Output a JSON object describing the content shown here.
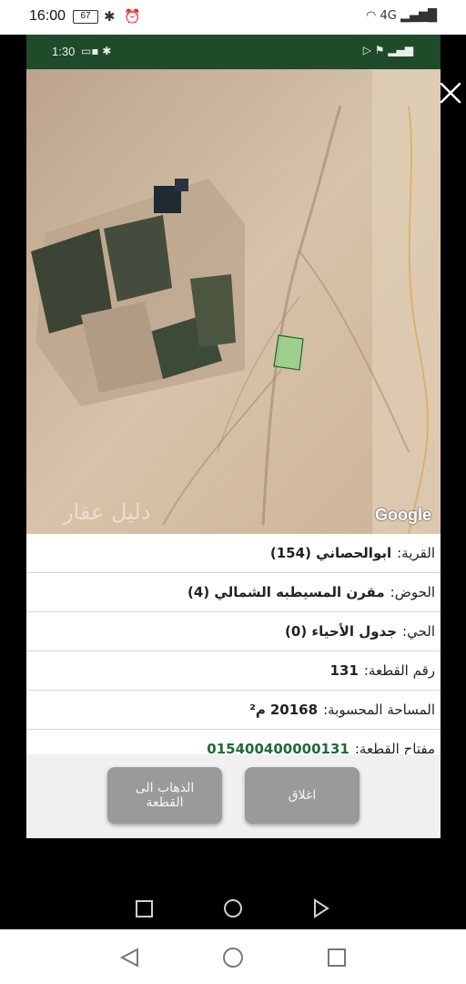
{
  "outer_status": {
    "time": "16:00",
    "battery": "67",
    "network": "4G"
  },
  "inner_status": {
    "time": "1:30"
  },
  "map": {
    "google_label": "Google",
    "watermark": "دليل عقار"
  },
  "parcel": {
    "village_label": "القرية:",
    "village_value": "ابوالحصاني (154)",
    "basin_label": "الحوض:",
    "basin_value": "مقرن المسيطبه الشمالي (4)",
    "district_label": "الحي:",
    "district_value": "جدول الأحياء (0)",
    "plot_no_label": "رقم القطعة:",
    "plot_no_value": "131",
    "area_label": "المساحة المحسوبة:",
    "area_value": "20168",
    "area_unit": "م²",
    "key_label": "مفتاح القطعة:",
    "key_value": "015400400000131"
  },
  "actions": {
    "close_label": "اغلاق",
    "go_label_line1": "الذهاب الى",
    "go_label_line2": "القطعة"
  },
  "colors": {
    "app_bar": "#1f4b2b",
    "accent": "#1f6a38",
    "button": "#9a9a9a"
  }
}
